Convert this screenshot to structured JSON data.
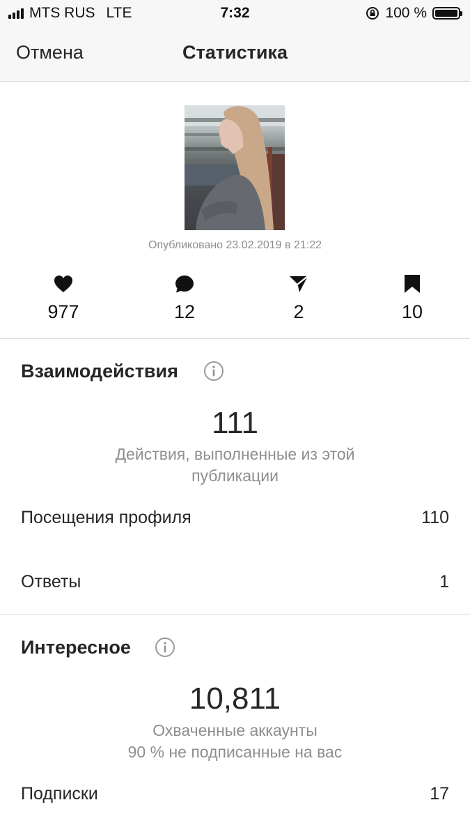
{
  "status_bar": {
    "carrier": "MTS RUS",
    "network": "LTE",
    "time": "7:32",
    "battery": "100 %"
  },
  "nav": {
    "cancel_label": "Отмена",
    "title": "Статистика"
  },
  "post": {
    "published": "Опубликовано 23.02.2019 в 21:22"
  },
  "metrics": [
    {
      "icon": "heart-icon",
      "value": "977"
    },
    {
      "icon": "comment-icon",
      "value": "12"
    },
    {
      "icon": "send-icon",
      "value": "2"
    },
    {
      "icon": "bookmark-icon",
      "value": "10"
    }
  ],
  "interactions": {
    "title": "Взаимодействия",
    "total": "111",
    "caption_line1": "Действия, выполненные из этой",
    "caption_line2": "публикации",
    "rows": [
      {
        "label": "Посещения профиля",
        "value": "110"
      },
      {
        "label": "Ответы",
        "value": "1"
      }
    ]
  },
  "discovery": {
    "title": "Интересное",
    "total": "10,811",
    "caption_line1": "Охваченные аккаунты",
    "caption_line2": "90 % не подписанные на вас",
    "rows": [
      {
        "label": "Подписки",
        "value": "17"
      }
    ]
  },
  "colors": {
    "text": "#262626",
    "muted": "#8e8e8e",
    "divider": "#dbdbdb",
    "bar_bg": "#f7f7f7"
  }
}
